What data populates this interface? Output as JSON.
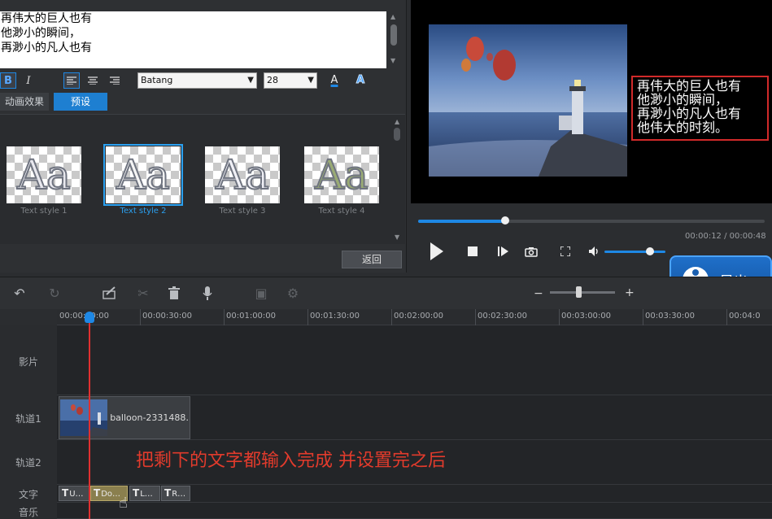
{
  "editor": {
    "text_lines": [
      "再伟大的巨人也有",
      "他渺小的瞬间，",
      "再渺小的凡人也有"
    ],
    "format": {
      "bold": "B",
      "italic": "I",
      "font": "Batang",
      "size": "28",
      "font_color_glyph": "A",
      "outline_glyph": "A"
    },
    "tabs": [
      {
        "label": "动画效果",
        "active": false
      },
      {
        "label": "预设",
        "active": true
      }
    ],
    "styles": [
      {
        "label": "Text style 1",
        "glyph": "Aa",
        "color": "#e8e8ee",
        "selected": false
      },
      {
        "label": "Text style 2",
        "glyph": "Aa",
        "color": "#f4f4f4",
        "selected": true
      },
      {
        "label": "Text style 3",
        "glyph": "Aa",
        "color": "#f0f0f6",
        "selected": false
      },
      {
        "label": "Text style 4",
        "glyph": "Aa",
        "color": "#9aab74",
        "selected": false
      }
    ],
    "back_label": "返回"
  },
  "preview": {
    "overlay_lines": [
      "再伟大的巨人也有",
      "他渺小的瞬间，",
      "再渺小的凡人也有",
      "他伟大的时刻。"
    ],
    "time_readout": "00:00:12 / 00:00:48",
    "progress": 0.25,
    "volume": 0.75
  },
  "export_label": "导出",
  "toolbar": {
    "icons": [
      "undo-icon",
      "redo-icon",
      "edit-icon",
      "cut-icon",
      "delete-icon",
      "mic-icon",
      "crop-icon",
      "settings-icon"
    ],
    "zoom_out": "−",
    "zoom_in": "+"
  },
  "ruler": {
    "labels": [
      "00:00:00:00",
      "00:00:30:00",
      "00:01:00:00",
      "00:01:30:00",
      "00:02:00:00",
      "00:02:30:00",
      "00:03:00:00",
      "00:03:30:00",
      "00:04:0"
    ]
  },
  "tracks": {
    "labels": [
      "影片",
      "轨道1",
      "轨道2",
      "文字",
      "音乐"
    ],
    "clip_name": "balloon-2331488…",
    "text_clips": [
      "U…",
      "Do…",
      "L…",
      "R…"
    ]
  },
  "subtitle": "把剩下的文字都输入完成 并设置完之后"
}
